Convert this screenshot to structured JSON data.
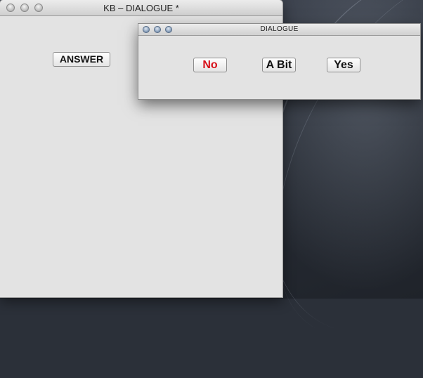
{
  "main_window": {
    "title": "KB – DIALOGUE *",
    "answer_button": "ANSWER"
  },
  "dialog_window": {
    "title": "DIALOGUE",
    "buttons": [
      {
        "label": "No",
        "color": "#d8101a"
      },
      {
        "label": "A Bit"
      },
      {
        "label": "Yes"
      }
    ]
  }
}
